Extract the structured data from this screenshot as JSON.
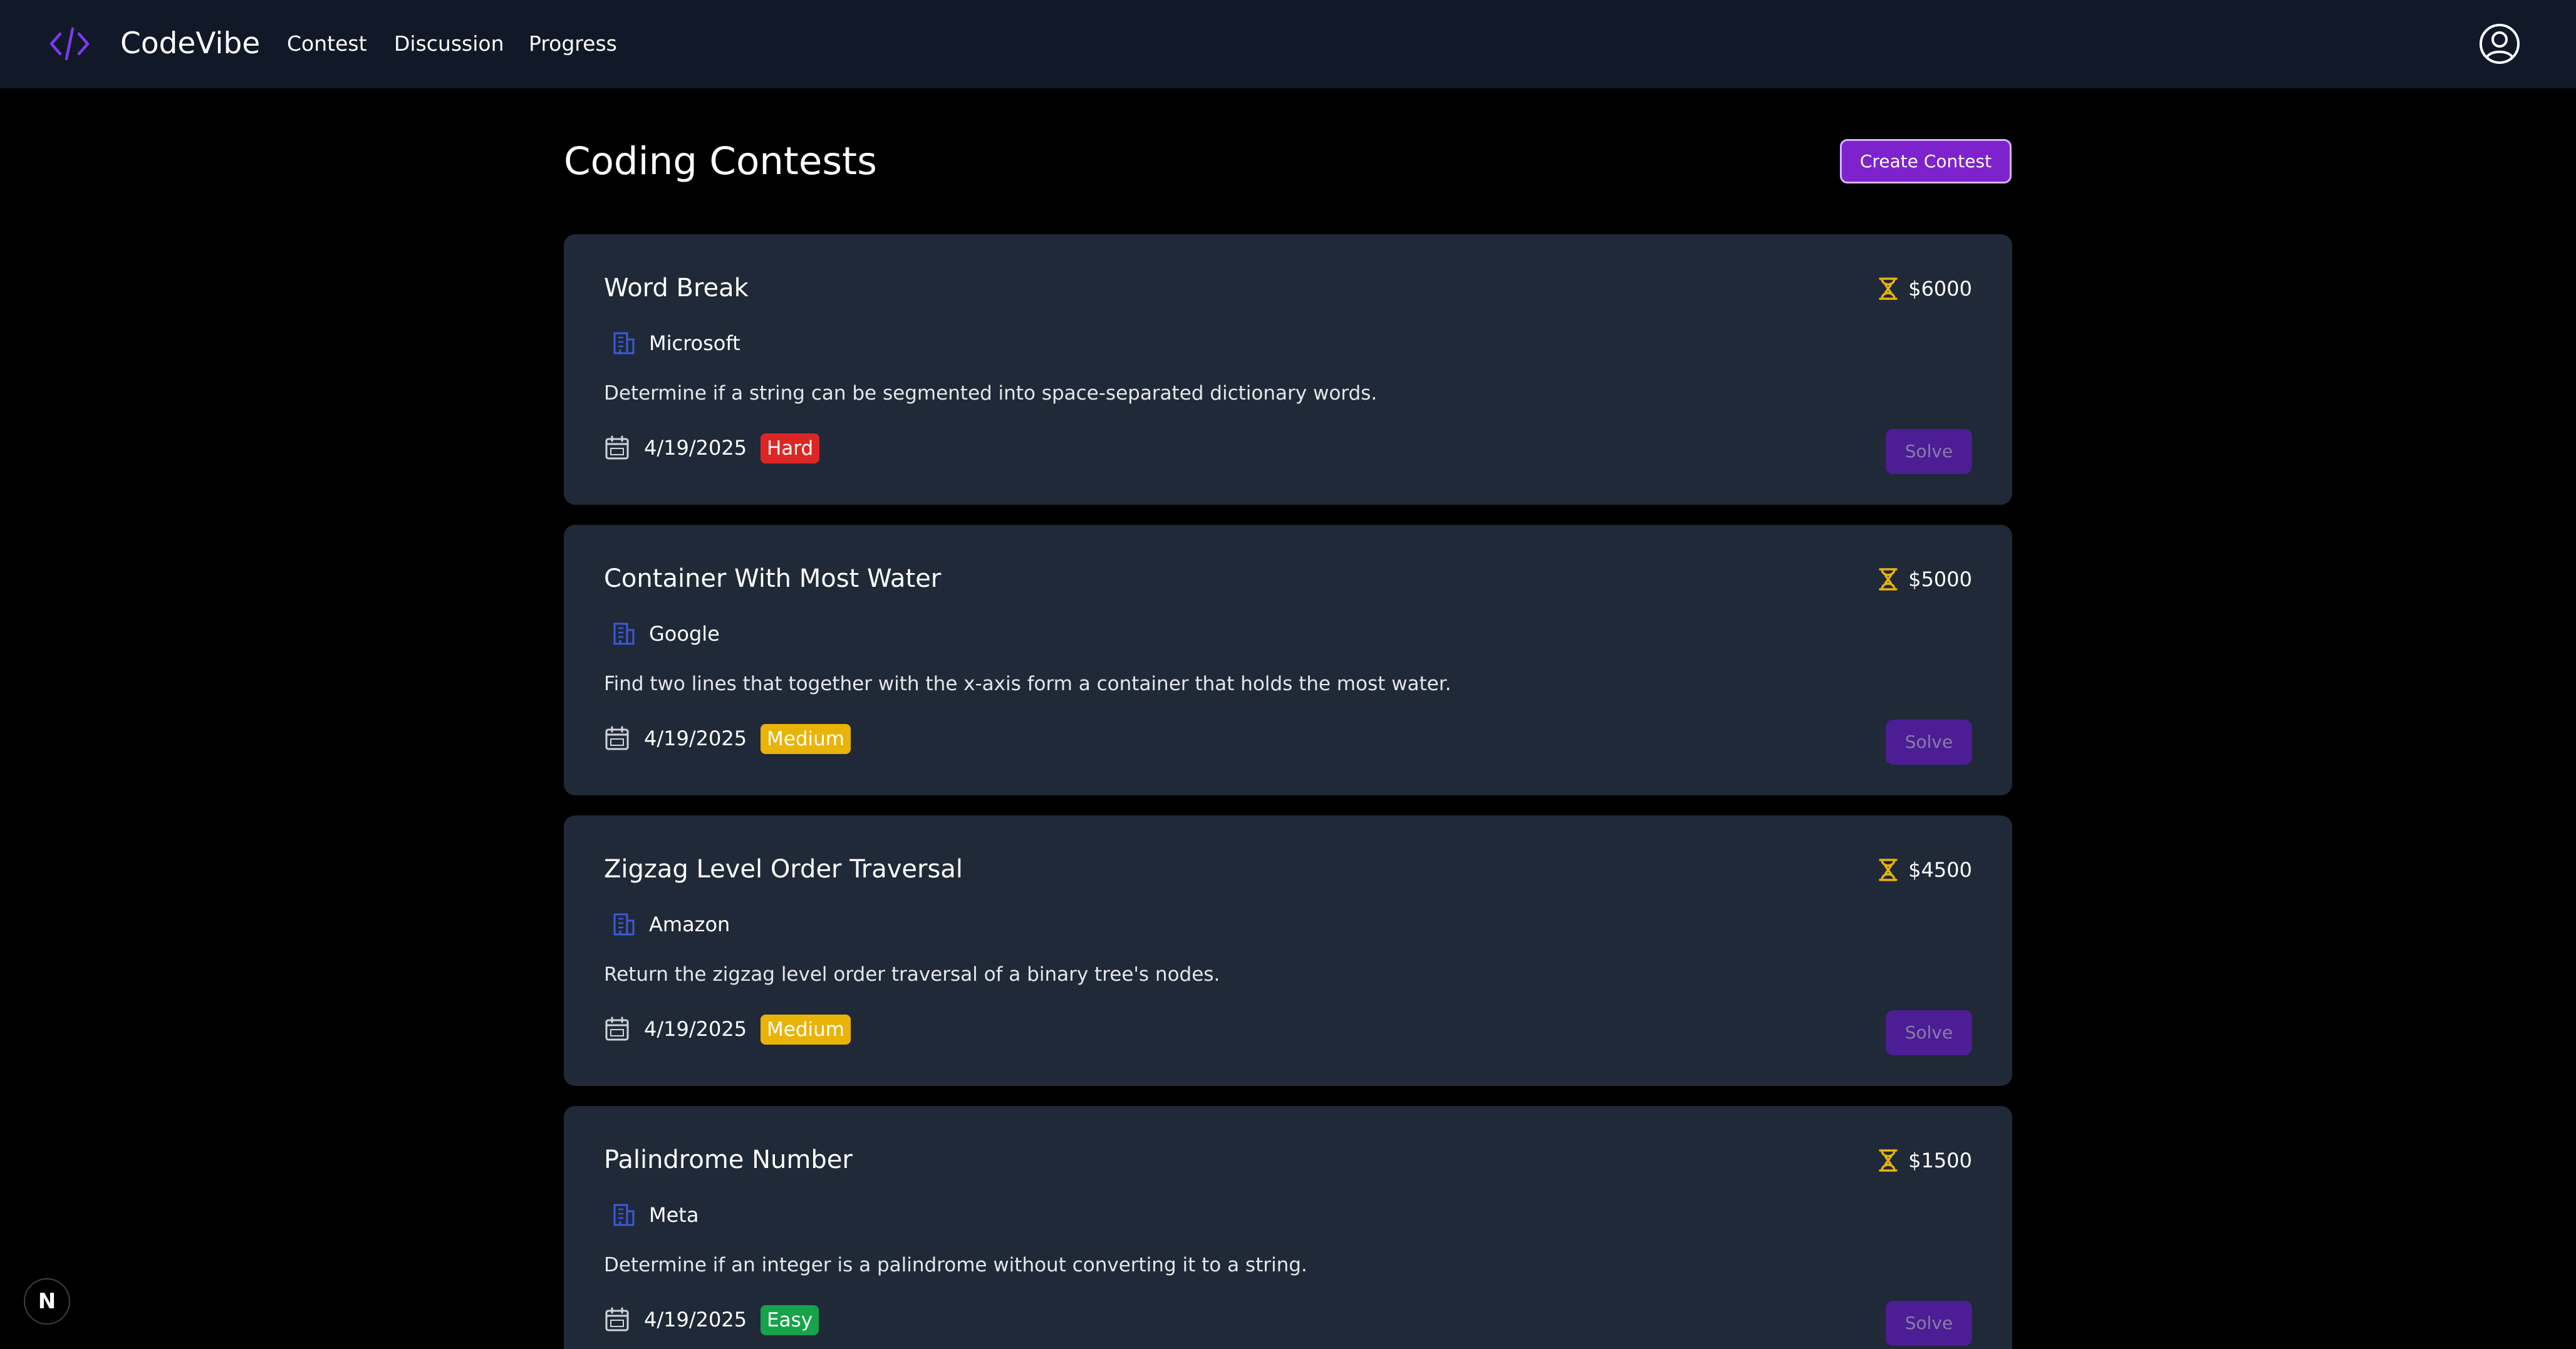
{
  "app": {
    "name": "CodeVibe",
    "logo_icon": "code-brackets-icon",
    "accent_color": "#7e22ce"
  },
  "nav": {
    "links": [
      {
        "label": "Contest"
      },
      {
        "label": "Discussion"
      },
      {
        "label": "Progress"
      }
    ],
    "profile_icon": "user-circle-icon"
  },
  "page": {
    "title": "Coding Contests",
    "create_button": "Create Contest"
  },
  "contests": [
    {
      "title": "Word Break",
      "prize": "$6000",
      "company": "Microsoft",
      "description": "Determine if a string can be segmented into space-separated dictionary words.",
      "date": "4/19/2025",
      "difficulty": "Hard",
      "difficulty_color": "#dc2626",
      "action": "Solve"
    },
    {
      "title": "Container With Most Water",
      "prize": "$5000",
      "company": "Google",
      "description": "Find two lines that together with the x-axis form a container that holds the most water.",
      "date": "4/19/2025",
      "difficulty": "Medium",
      "difficulty_color": "#eab308",
      "action": "Solve"
    },
    {
      "title": "Zigzag Level Order Traversal",
      "prize": "$4500",
      "company": "Amazon",
      "description": "Return the zigzag level order traversal of a binary tree's nodes.",
      "date": "4/19/2025",
      "difficulty": "Medium",
      "difficulty_color": "#eab308",
      "action": "Solve"
    },
    {
      "title": "Palindrome Number",
      "prize": "$1500",
      "company": "Meta",
      "description": "Determine if an integer is a palindrome without converting it to a string.",
      "date": "4/19/2025",
      "difficulty": "Easy",
      "difficulty_color": "#16a34a",
      "action": "Solve"
    }
  ],
  "floating_badge": {
    "label": "N",
    "icon": "nextjs-icon"
  }
}
